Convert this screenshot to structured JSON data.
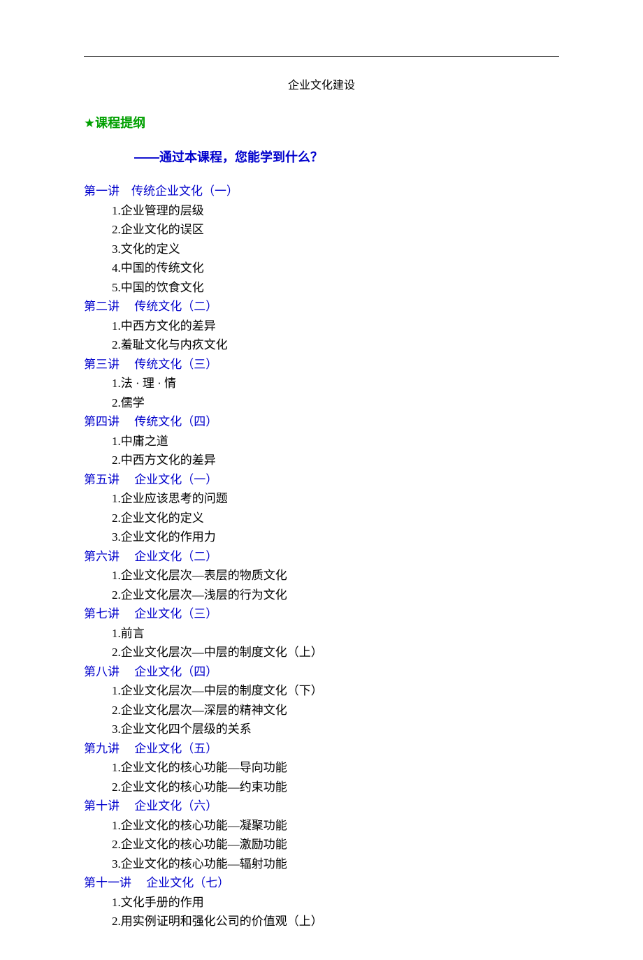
{
  "doc_title": "企业文化建设",
  "star": "★",
  "outline_label": "课程提纲",
  "subtitle": "——通过本课程，您能学到什么？",
  "lectures": [
    {
      "heading": "第一讲　传统企业文化（一）",
      "items": [
        "1.企业管理的层级",
        "2.企业文化的误区",
        "3.文化的定义",
        "4.中国的传统文化",
        "5.中国的饮食文化"
      ]
    },
    {
      "heading": "第二讲　 传统文化（二）",
      "items": [
        "1.中西方文化的差异",
        "2.羞耻文化与内疚文化"
      ]
    },
    {
      "heading": "第三讲　 传统文化（三）",
      "items": [
        "1.法 · 理 · 情",
        "2.儒学"
      ]
    },
    {
      "heading": "第四讲　 传统文化（四）",
      "items": [
        "1.中庸之道",
        "2.中西方文化的差异"
      ]
    },
    {
      "heading": "第五讲　 企业文化（一）",
      "items": [
        "1.企业应该思考的问题",
        "2.企业文化的定义",
        "3.企业文化的作用力"
      ]
    },
    {
      "heading": "第六讲　 企业文化（二）",
      "items": [
        "1.企业文化层次—表层的物质文化",
        "2.企业文化层次—浅层的行为文化"
      ]
    },
    {
      "heading": "第七讲　 企业文化（三）",
      "items": [
        "1.前言",
        "2.企业文化层次—中层的制度文化（上）"
      ]
    },
    {
      "heading": "第八讲　 企业文化（四）",
      "items": [
        "1.企业文化层次—中层的制度文化（下）",
        "2.企业文化层次—深层的精神文化",
        "3.企业文化四个层级的关系"
      ]
    },
    {
      "heading": "第九讲　 企业文化（五）",
      "items": [
        "1.企业文化的核心功能—导向功能",
        "2.企业文化的核心功能—约束功能"
      ]
    },
    {
      "heading": "第十讲　 企业文化（六）",
      "items": [
        "1.企业文化的核心功能—凝聚功能",
        "2.企业文化的核心功能—激励功能",
        "3.企业文化的核心功能—辐射功能"
      ]
    },
    {
      "heading": "第十一讲　 企业文化（七）",
      "items": [
        "1.文化手册的作用",
        "2.用实例证明和强化公司的价值观（上）"
      ]
    }
  ]
}
